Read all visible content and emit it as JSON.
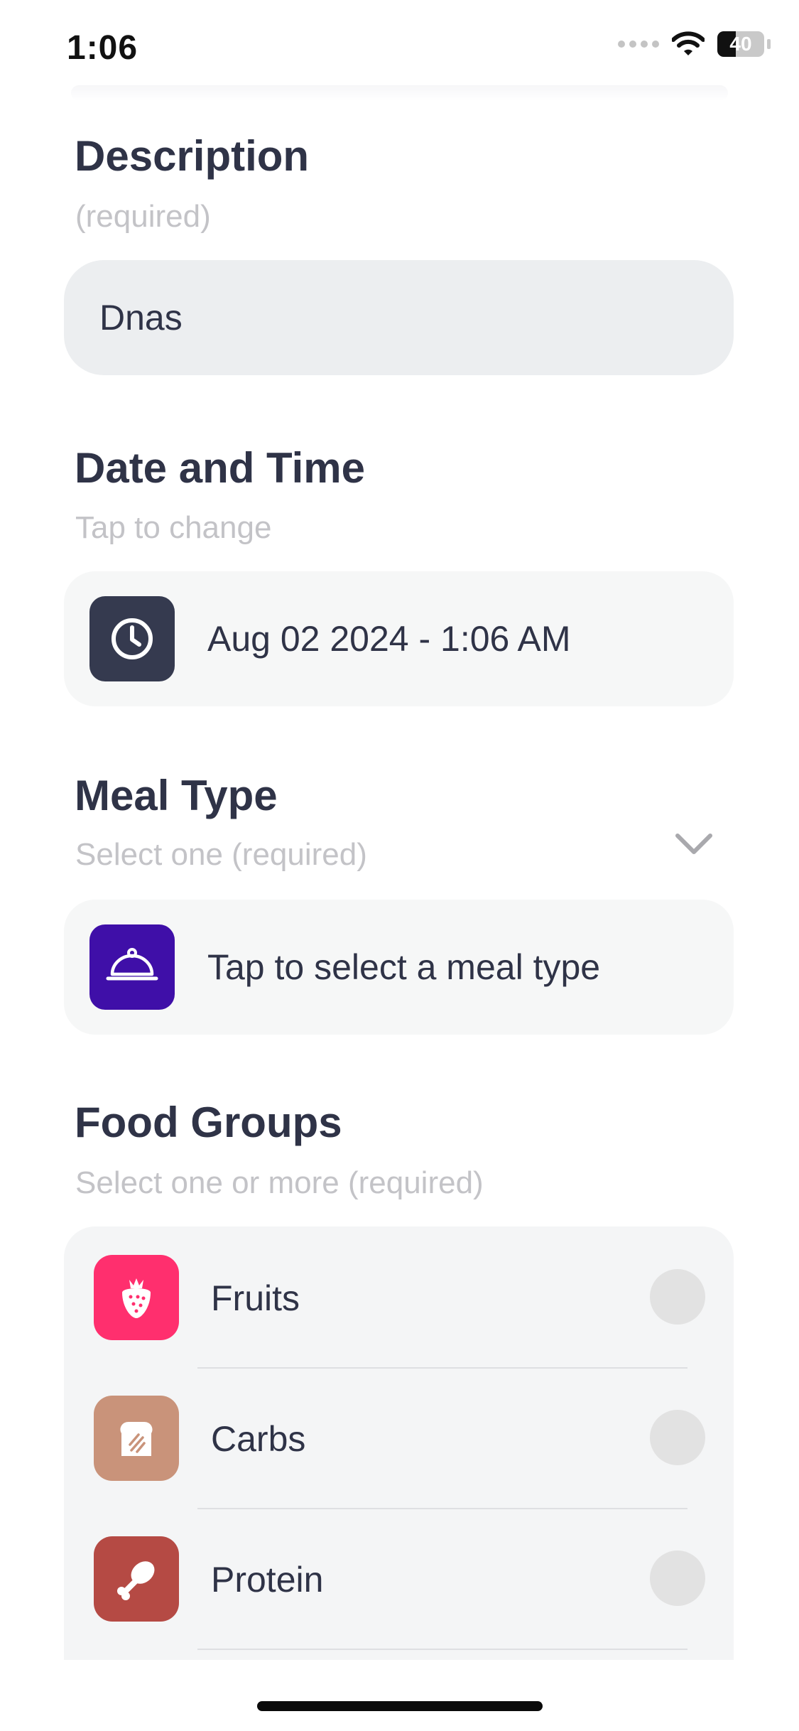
{
  "status_bar": {
    "time": "1:06",
    "battery": "40",
    "battery_level": 0.4
  },
  "description": {
    "title": "Description",
    "subtitle": "(required)",
    "value": "Dnas"
  },
  "date_time": {
    "title": "Date and Time",
    "subtitle": "Tap to change",
    "value": "Aug 02 2024 - 1:06 AM",
    "icon": "clock-icon",
    "icon_color": "#353a4f"
  },
  "meal_type": {
    "title": "Meal Type",
    "subtitle": "Select one (required)",
    "placeholder": "Tap to select a meal type",
    "icon": "cloche-icon",
    "icon_color": "#3f0fa8"
  },
  "food_groups": {
    "title": "Food Groups",
    "subtitle": "Select one or more (required)",
    "items": [
      {
        "label": "Fruits",
        "icon": "strawberry-icon",
        "color": "#ff2f6e",
        "selected": false
      },
      {
        "label": "Carbs",
        "icon": "bread-icon",
        "color": "#c9937a",
        "selected": false
      },
      {
        "label": "Protein",
        "icon": "drumstick-icon",
        "color": "#b54a44",
        "selected": false
      }
    ]
  }
}
